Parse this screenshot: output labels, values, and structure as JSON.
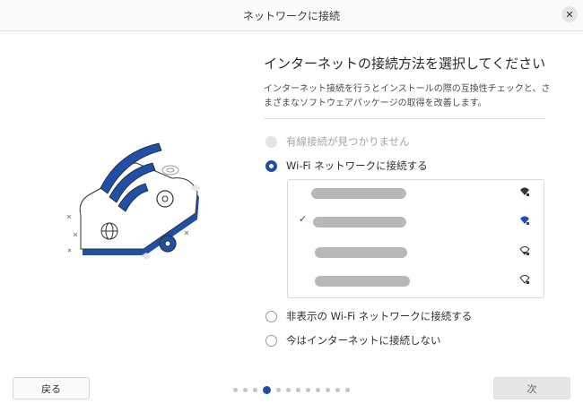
{
  "window": {
    "title": "ネットワークに接続",
    "close_glyph": "✕"
  },
  "main": {
    "heading": "インターネットの接続方法を選択してください",
    "description": "インターネット接続を行うとインストールの際の互換性チェックと、さまざまなソフトウェアパッケージの取得を改善します。",
    "options": [
      {
        "label": "有線接続が見つかりません",
        "state": "disabled"
      },
      {
        "label": "Wi-Fi ネットワークに接続する",
        "state": "selected"
      },
      {
        "label": "非表示の Wi-Fi ネットワークに接続する",
        "state": "unselected"
      },
      {
        "label": "今はインターネットに接続しない",
        "state": "unselected"
      }
    ],
    "wifi_networks": [
      {
        "ssid_redacted": true,
        "selected": false,
        "signal_icon": "wifi-signal-strong-secured-icon"
      },
      {
        "ssid_redacted": true,
        "selected": true,
        "check_glyph": "✓",
        "signal_icon": "wifi-signal-strong-secured-icon"
      },
      {
        "ssid_redacted": true,
        "selected": false,
        "signal_icon": "wifi-signal-weak-secured-icon"
      },
      {
        "ssid_redacted": true,
        "selected": false,
        "signal_icon": "wifi-signal-weak-secured-icon"
      }
    ]
  },
  "footer": {
    "back_label": "戻る",
    "next_label": "次",
    "page_count": 12,
    "current_page_index": 3
  },
  "colors": {
    "accent": "#1f4fa6",
    "redacted_bar": "#b8b8b8",
    "disabled": "#e4e4e4"
  }
}
